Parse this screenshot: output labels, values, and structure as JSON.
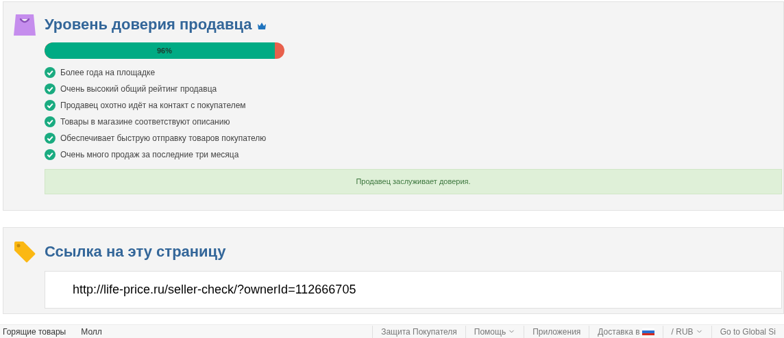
{
  "trust_panel": {
    "title": "Уровень доверия продавца",
    "progress": {
      "level": 0.96,
      "reading": "96%"
    },
    "criteria": [
      {
        "text": "Более года на площадке",
        "checked": true
      },
      {
        "text": "Очень высокий общий рейтинг продавца",
        "checked": true
      },
      {
        "text": "Продавец охотно идёт на контакт с покупателем",
        "checked": true
      },
      {
        "text": "Товары в магазине соответствуют описанию",
        "checked": true
      },
      {
        "text": "Обеспечивает быструю отправку товаров покупателю",
        "checked": true
      },
      {
        "text": "Очень много продаж за последние три месяца",
        "checked": true
      }
    ],
    "verdict": "Продавец заслуживает доверия."
  },
  "link_panel": {
    "title": "Ссылка на эту страницу",
    "url": "http://life-price.ru/seller-check/?ownerId=112666705"
  },
  "footer": {
    "left": [
      "Горящие товары",
      "Молл"
    ],
    "right": [
      {
        "label": "Защита Покупателя",
        "kind": "link"
      },
      {
        "label": "Помощь",
        "kind": "dropdown"
      },
      {
        "label": "Приложения",
        "kind": "link"
      },
      {
        "label": "Доставка в",
        "kind": "flag"
      },
      {
        "label": "/ RUB",
        "kind": "dropdown"
      },
      {
        "label": "Go to Global Si",
        "kind": "link"
      }
    ]
  }
}
